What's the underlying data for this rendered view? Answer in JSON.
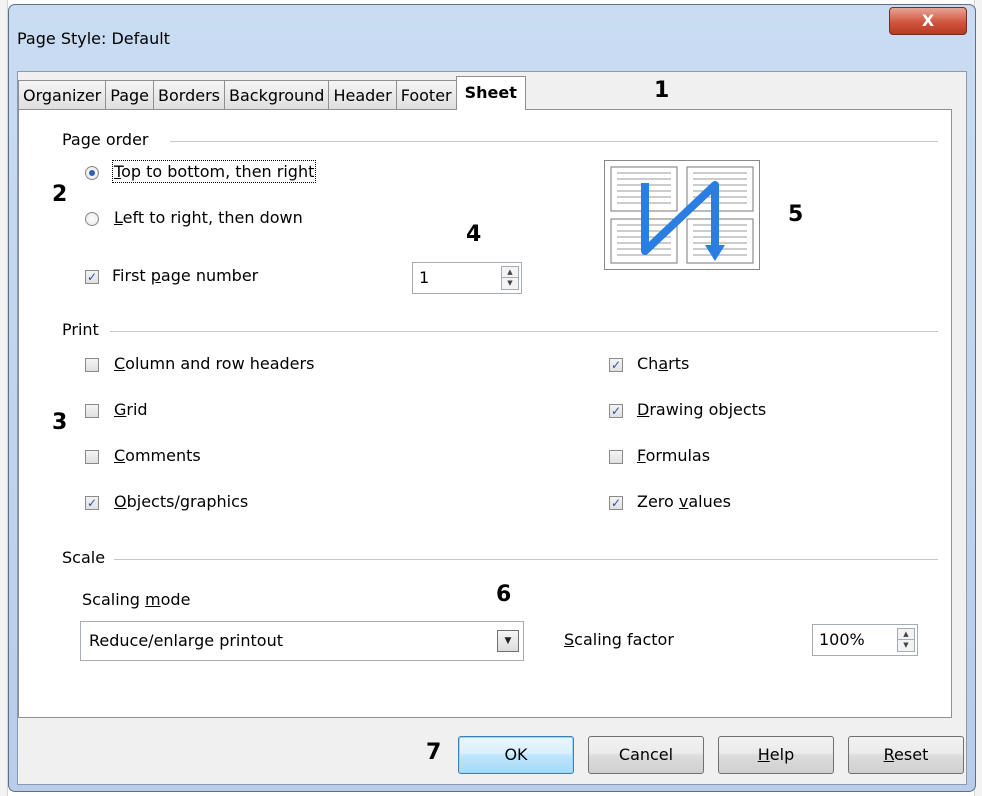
{
  "window": {
    "title": "Page Style: Default",
    "close_glyph": "X"
  },
  "tabs": [
    {
      "label": "Organizer"
    },
    {
      "label": "Page"
    },
    {
      "label": "Borders"
    },
    {
      "label": "Background"
    },
    {
      "label": "Header"
    },
    {
      "label": "Footer"
    },
    {
      "label": "Sheet",
      "active": true
    }
  ],
  "annotations": {
    "a1": "1",
    "a2": "2",
    "a3": "3",
    "a4": "4",
    "a5": "5",
    "a6": "6",
    "a7": "7"
  },
  "page_order": {
    "section": "Page order",
    "option1": {
      "pre": "",
      "u": "T",
      "post": "op to bottom, then right",
      "selected": true
    },
    "option2": {
      "pre": "",
      "u": "L",
      "post": "eft to right, then down",
      "selected": false
    },
    "first_page": {
      "pre": "First ",
      "u": "p",
      "post": "age number",
      "checked": true,
      "value": "1"
    }
  },
  "print": {
    "section": "Print",
    "col_row": {
      "pre": "",
      "u": "C",
      "post": "olumn and row headers",
      "checked": false
    },
    "grid": {
      "pre": "",
      "u": "G",
      "post": "rid",
      "checked": false
    },
    "comments": {
      "pre": "",
      "u": "C",
      "post": "omments",
      "checked": false
    },
    "objects": {
      "pre": "",
      "u": "O",
      "post": "bjects/graphics",
      "checked": true
    },
    "charts": {
      "pre": "Ch",
      "u": "a",
      "post": "rts",
      "checked": true
    },
    "drawing": {
      "pre": "",
      "u": "D",
      "post": "rawing objects",
      "checked": true
    },
    "formulas": {
      "pre": "",
      "u": "F",
      "post": "ormulas",
      "checked": false
    },
    "zero": {
      "pre": "Zero ",
      "u": "v",
      "post": "alues",
      "checked": true
    }
  },
  "scale": {
    "section": "Scale",
    "mode_label": {
      "pre": "Scaling ",
      "u": "m",
      "post": "ode"
    },
    "mode_value": "Reduce/enlarge printout",
    "factor_label": {
      "pre": "",
      "u": "S",
      "post": "caling factor"
    },
    "factor_value": "100%"
  },
  "buttons": {
    "ok": "OK",
    "cancel": "Cancel",
    "help": {
      "pre": "",
      "u": "H",
      "post": "elp"
    },
    "reset": {
      "pre": "",
      "u": "R",
      "post": "eset"
    }
  },
  "colors": {
    "accent": "#2a7de1",
    "title_bar": "#c9dcf2",
    "close": "#d1553d"
  }
}
